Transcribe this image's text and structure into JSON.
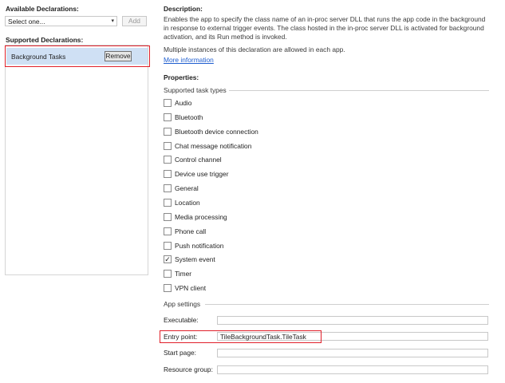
{
  "left": {
    "available_label": "Available Declarations:",
    "select_value": "Select one...",
    "add_label": "Add",
    "supported_label": "Supported Declarations:",
    "declarations": [
      {
        "label": "Background Tasks",
        "remove_label": "Remove"
      }
    ]
  },
  "right": {
    "description_label": "Description:",
    "description_text": "Enables the app to specify the class name of an in-proc server DLL that runs the app code in the background in response to external trigger events. The class hosted in the in-proc server DLL is activated for background activation, and its Run method is invoked.",
    "multiple_text": "Multiple instances of this declaration are allowed in each app.",
    "more_info": "More information",
    "properties_label": "Properties:",
    "task_types_label": "Supported task types",
    "task_types": [
      {
        "label": "Audio",
        "checked": false
      },
      {
        "label": "Bluetooth",
        "checked": false
      },
      {
        "label": "Bluetooth device connection",
        "checked": false
      },
      {
        "label": "Chat message notification",
        "checked": false
      },
      {
        "label": "Control channel",
        "checked": false
      },
      {
        "label": "Device use trigger",
        "checked": false
      },
      {
        "label": "General",
        "checked": false
      },
      {
        "label": "Location",
        "checked": false
      },
      {
        "label": "Media processing",
        "checked": false
      },
      {
        "label": "Phone call",
        "checked": false
      },
      {
        "label": "Push notification",
        "checked": false
      },
      {
        "label": "System event",
        "checked": true
      },
      {
        "label": "Timer",
        "checked": false
      },
      {
        "label": "VPN client",
        "checked": false
      }
    ],
    "app_settings_label": "App settings",
    "fields": [
      {
        "label": "Executable:",
        "value": ""
      },
      {
        "label": "Entry point:",
        "value": "TileBackgroundTask.TileTask"
      },
      {
        "label": "Start page:",
        "value": ""
      },
      {
        "label": "Resource group:",
        "value": ""
      }
    ]
  },
  "colors": {
    "highlight_red": "#e0202a",
    "selection_blue": "#cfe0f4",
    "link_blue": "#1f5ecf"
  }
}
